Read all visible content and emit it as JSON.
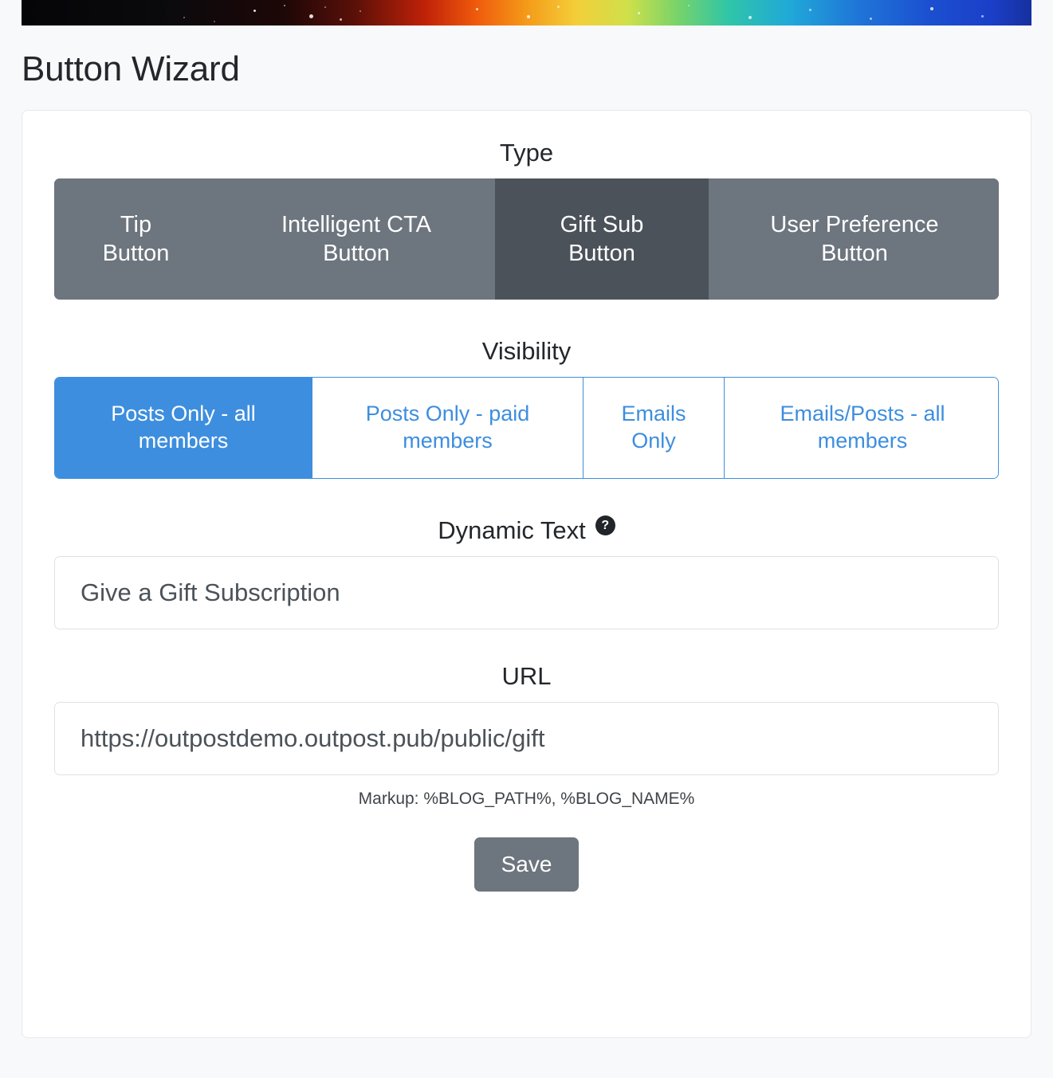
{
  "banner": {
    "name": "decorative-rainbow-starfield-banner",
    "gradient_colors": [
      "#050508",
      "#c02208",
      "#ef5a0c",
      "#f59a18",
      "#f3cf3a",
      "#77d36a",
      "#2fc5a8",
      "#20a9d8",
      "#1f74d8",
      "#16309f"
    ]
  },
  "page": {
    "title": "Button Wizard",
    "background_color": "#f7f9fb",
    "card_background": "#ffffff"
  },
  "type_section": {
    "label": "Type",
    "active_index": 2,
    "active_color": "#4b525a",
    "inactive_color": "#6d757e",
    "options": [
      {
        "line1": "Tip",
        "line2": "Button",
        "label": "Tip Button"
      },
      {
        "line1": "Intelligent CTA",
        "line2": "Button",
        "label": "Intelligent CTA Button"
      },
      {
        "line1": "Gift Sub",
        "line2": "Button",
        "label": "Gift Sub Button"
      },
      {
        "line1": "User Preference",
        "line2": "Button",
        "label": "User Preference Button"
      }
    ]
  },
  "visibility_section": {
    "label": "Visibility",
    "active_index": 0,
    "accent_color": "#3d8ede",
    "options": [
      {
        "line1": "Posts Only - all",
        "line2": "members",
        "label": "Posts Only - all members"
      },
      {
        "line1": "Posts Only - paid",
        "line2": "members",
        "label": "Posts Only - paid members"
      },
      {
        "line1": "Emails",
        "line2": "Only",
        "label": "Emails Only"
      },
      {
        "line1": "Emails/Posts - all",
        "line2": "members",
        "label": "Emails/Posts - all members"
      }
    ]
  },
  "dynamic_text_section": {
    "label": "Dynamic Text",
    "help_icon": "question-mark-circle-icon",
    "help_glyph": "?",
    "value": "Give a Gift Subscription",
    "placeholder": "Give a Gift Subscription"
  },
  "url_section": {
    "label": "URL",
    "value": "https://outpostdemo.outpost.pub/public/gift",
    "placeholder": "https://outpostdemo.outpost.pub/public/gift",
    "hint": "Markup: %BLOG_PATH%, %BLOG_NAME%"
  },
  "actions": {
    "save_label": "Save",
    "save_color": "#6d757e"
  }
}
